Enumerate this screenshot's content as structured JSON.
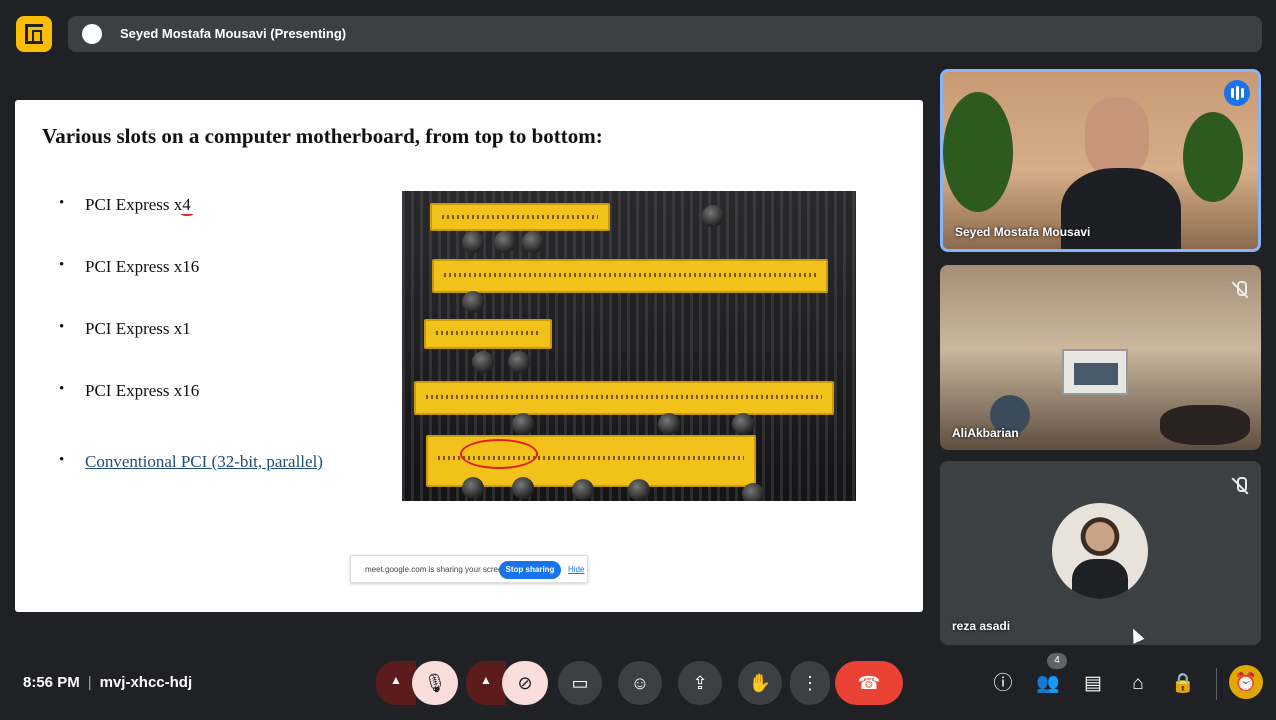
{
  "header": {
    "presenter_label": "Seyed Mostafa Mousavi (Presenting)"
  },
  "slide": {
    "title": "Various slots on a computer motherboard, from top to bottom:",
    "bullets": [
      "PCI Express x4",
      "PCI Express x16",
      "PCI Express x1",
      "PCI Express x16",
      "Conventional PCI (32-bit, parallel)"
    ]
  },
  "share_notice": {
    "text": "meet.google.com is sharing your screen.",
    "stop_label": "Stop sharing",
    "hide_label": "Hide"
  },
  "participants": [
    {
      "name": "Seyed Mostafa Mousavi",
      "speaking": true
    },
    {
      "name": "AliAkbarian",
      "muted": true
    },
    {
      "name": "reza asadi",
      "muted": true
    }
  ],
  "footer": {
    "time": "8:56 PM",
    "separator": "|",
    "meeting_code": "mvj-xhcc-hdj",
    "people_count": "4"
  },
  "colors": {
    "accent_blue": "#1a73e8",
    "end_call_red": "#ea4335",
    "logo_yellow": "#fbbc04"
  }
}
